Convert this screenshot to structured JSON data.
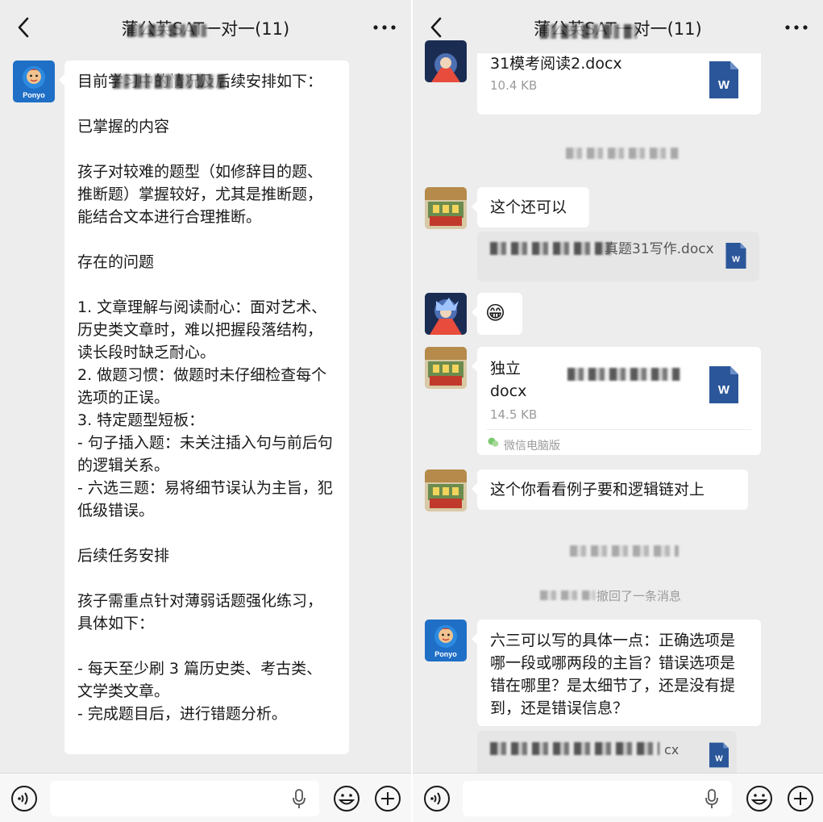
{
  "left": {
    "title": "蒲公英SAT一对一(11)",
    "avatar_text": "Ponyo",
    "message": "目前学习中的情况及后续安排如下：\n\n已掌握的内容\n\n孩子对较难的题型（如修辞目的题、推断题）掌握较好，尤其是推断题，能结合文本进行合理推断。\n\n存在的问题\n\n1. 文章理解与阅读耐心：面对艺术、历史类文章时，难以把握段落结构，读长段时缺乏耐心。\n2. 做题习惯：做题时未仔细检查每个选项的正误。\n3. 特定题型短板：\n- 句子插入题：未关注插入句与前后句的逻辑关系。\n- 六选三题：易将细节误认为主旨，犯低级错误。\n\n后续任务安排\n\n孩子需重点针对薄弱话题强化练习，具体如下：\n\n- 每天至少刷 3 篇历史类、考古类、文学类文章。\n- 完成题目后，进行错题分析。"
  },
  "right": {
    "title": "蒲公英SAT一对一(11)",
    "avatar_text": "Ponyo",
    "file1": {
      "name": "31模考阅读2.docx",
      "size": "10.4 KB"
    },
    "msg1": "这个还可以",
    "file2_name": "真题31写作.docx",
    "emoji": "😁",
    "file3": {
      "name_line1": "独立",
      "name_line2": "docx",
      "size": "14.5 KB",
      "source": "微信电脑版"
    },
    "msg2": "这个你看看例子要和逻辑链对上",
    "recall_notice": "撤回了一条消息",
    "msg3": "六三可以写的具体一点：正确选项是哪一段或哪两段的主旨？错误选项是错在哪里？是太细节了，还是没有提到，还是错误信息？",
    "file4_name": "cx"
  },
  "icons": {
    "back": "chevron-left-icon",
    "more": "more-dots-icon",
    "word": "word-doc-icon",
    "voice": "voice-icon",
    "mic": "mic-icon",
    "emoji": "emoji-icon",
    "add": "add-icon"
  },
  "colors": {
    "background": "#ededed",
    "bubble": "#ffffff",
    "word_blue": "#2b579a",
    "meta_gray": "#9b9b9b"
  }
}
